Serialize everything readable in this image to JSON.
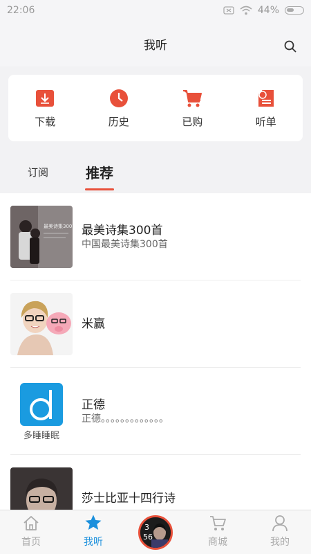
{
  "status": {
    "time": "22:06",
    "battery": "44%"
  },
  "header": {
    "title": "我听"
  },
  "quick": [
    {
      "label": "下载",
      "icon": "download-icon"
    },
    {
      "label": "历史",
      "icon": "clock-icon"
    },
    {
      "label": "已购",
      "icon": "cart-icon"
    },
    {
      "label": "听单",
      "icon": "playlist-icon"
    }
  ],
  "tabs": [
    {
      "label": "订阅",
      "active": false
    },
    {
      "label": "推荐",
      "active": true
    }
  ],
  "list": [
    {
      "title": "最美诗集300首",
      "subtitle": "中国最美诗集300首",
      "thumb_text": "最美诗集300首"
    },
    {
      "title": "米赢",
      "subtitle": ""
    },
    {
      "title": "正德",
      "subtitle": "正德。。。。。。。。。。。。。",
      "thumb_text": "多睡睡眠"
    },
    {
      "title": "莎士比亚十四行诗",
      "subtitle": ""
    }
  ],
  "tabbar": [
    {
      "label": "首页",
      "icon": "home-icon",
      "active": false
    },
    {
      "label": "我听",
      "icon": "star-icon",
      "active": true
    },
    {
      "label": "",
      "icon": "album-disc-icon",
      "active": false
    },
    {
      "label": "商城",
      "icon": "cart-icon",
      "active": false
    },
    {
      "label": "我的",
      "icon": "person-icon",
      "active": false
    }
  ],
  "colors": {
    "accent": "#e8503a",
    "active_tab": "#1a8fdc"
  }
}
